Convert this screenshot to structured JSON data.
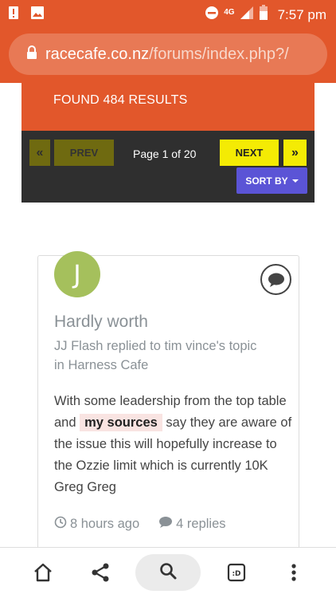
{
  "status_bar": {
    "network": "4G",
    "time": "7:57 pm"
  },
  "browser": {
    "url_domain": "racecafe.co.nz",
    "url_path": "/forums/index.php?/"
  },
  "results": {
    "label": "FOUND 484 RESULTS"
  },
  "pagination": {
    "first_symbol": "«",
    "prev_label": "PREV",
    "page_info": "Page 1 of 20",
    "next_label": "NEXT",
    "last_symbol": "»",
    "sort_label": "SORT BY"
  },
  "post": {
    "avatar_letter": "J",
    "title": "Hardly worth",
    "meta_author": "JJ Flash",
    "meta_replied": " replied to ",
    "meta_target": "tim vince's topic",
    "meta_in": "in ",
    "meta_forum": "Harness Cafe",
    "body_1": "With some leadership from the top table and ",
    "body_highlight": "my   sources",
    "body_2": " say they are aware of the issue this will hopefully increase to the Ozzie limit which is currently 10K Greg Greg",
    "time_ago": "8 hours ago",
    "replies": "4 replies"
  },
  "colors": {
    "brand_orange": "#e2572b",
    "sort_purple": "#5b54d6",
    "next_yellow": "#f4eb04",
    "avatar_green": "#a5c05c"
  },
  "icons": {
    "status_left": [
      "alert-icon",
      "image-icon"
    ],
    "status_right": [
      "dnd-icon",
      "signal-icon",
      "battery-icon"
    ],
    "bottom_nav": [
      "home-icon",
      "share-icon",
      "search-icon",
      "tabs-icon",
      "menu-icon"
    ]
  }
}
